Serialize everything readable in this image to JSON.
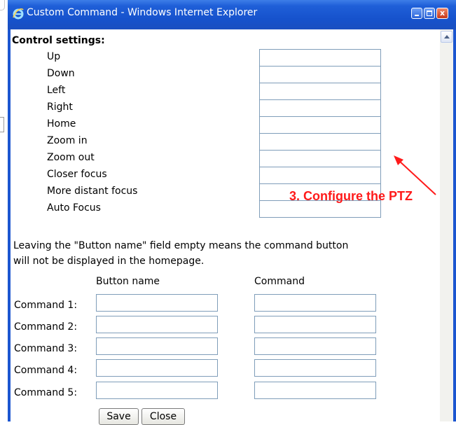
{
  "window": {
    "title": "Custom Command - Windows Internet Explorer",
    "close_glyph": "x"
  },
  "control_settings": {
    "heading": "Control settings:",
    "items": [
      "Up",
      "Down",
      "Left",
      "Right",
      "Home",
      "Zoom in",
      "Zoom out",
      "Closer focus",
      "More distant focus",
      "Auto Focus"
    ],
    "values": [
      "",
      "",
      "",
      "",
      "",
      "",
      "",
      "",
      "",
      ""
    ]
  },
  "note": {
    "line1": "Leaving the \"Button name\" field empty means the command button",
    "line2": "will not be displayed in the homepage."
  },
  "commands": {
    "header_button_name": "Button name",
    "header_command": "Command",
    "rows": [
      {
        "label": "Command 1:",
        "button_name": "",
        "command": ""
      },
      {
        "label": "Command 2:",
        "button_name": "",
        "command": ""
      },
      {
        "label": "Command 3:",
        "button_name": "",
        "command": ""
      },
      {
        "label": "Command 4:",
        "button_name": "",
        "command": ""
      },
      {
        "label": "Command 5:",
        "button_name": "",
        "command": ""
      }
    ]
  },
  "buttons": {
    "save": "Save",
    "close": "Close"
  },
  "annotation": {
    "text": "3. Configure the PTZ",
    "color": "#ff1a1a"
  },
  "icons": {
    "app": "ie-logo-icon",
    "minimize": "minimize-icon",
    "maximize": "maximize-icon",
    "close": "close-icon",
    "scroll_up": "scroll-up-arrow-icon",
    "annotation_arrow": "arrow-icon"
  },
  "colors": {
    "titlebar": "#1652cc",
    "field_border": "#7f9db9",
    "annotation": "#ff1a1a"
  }
}
